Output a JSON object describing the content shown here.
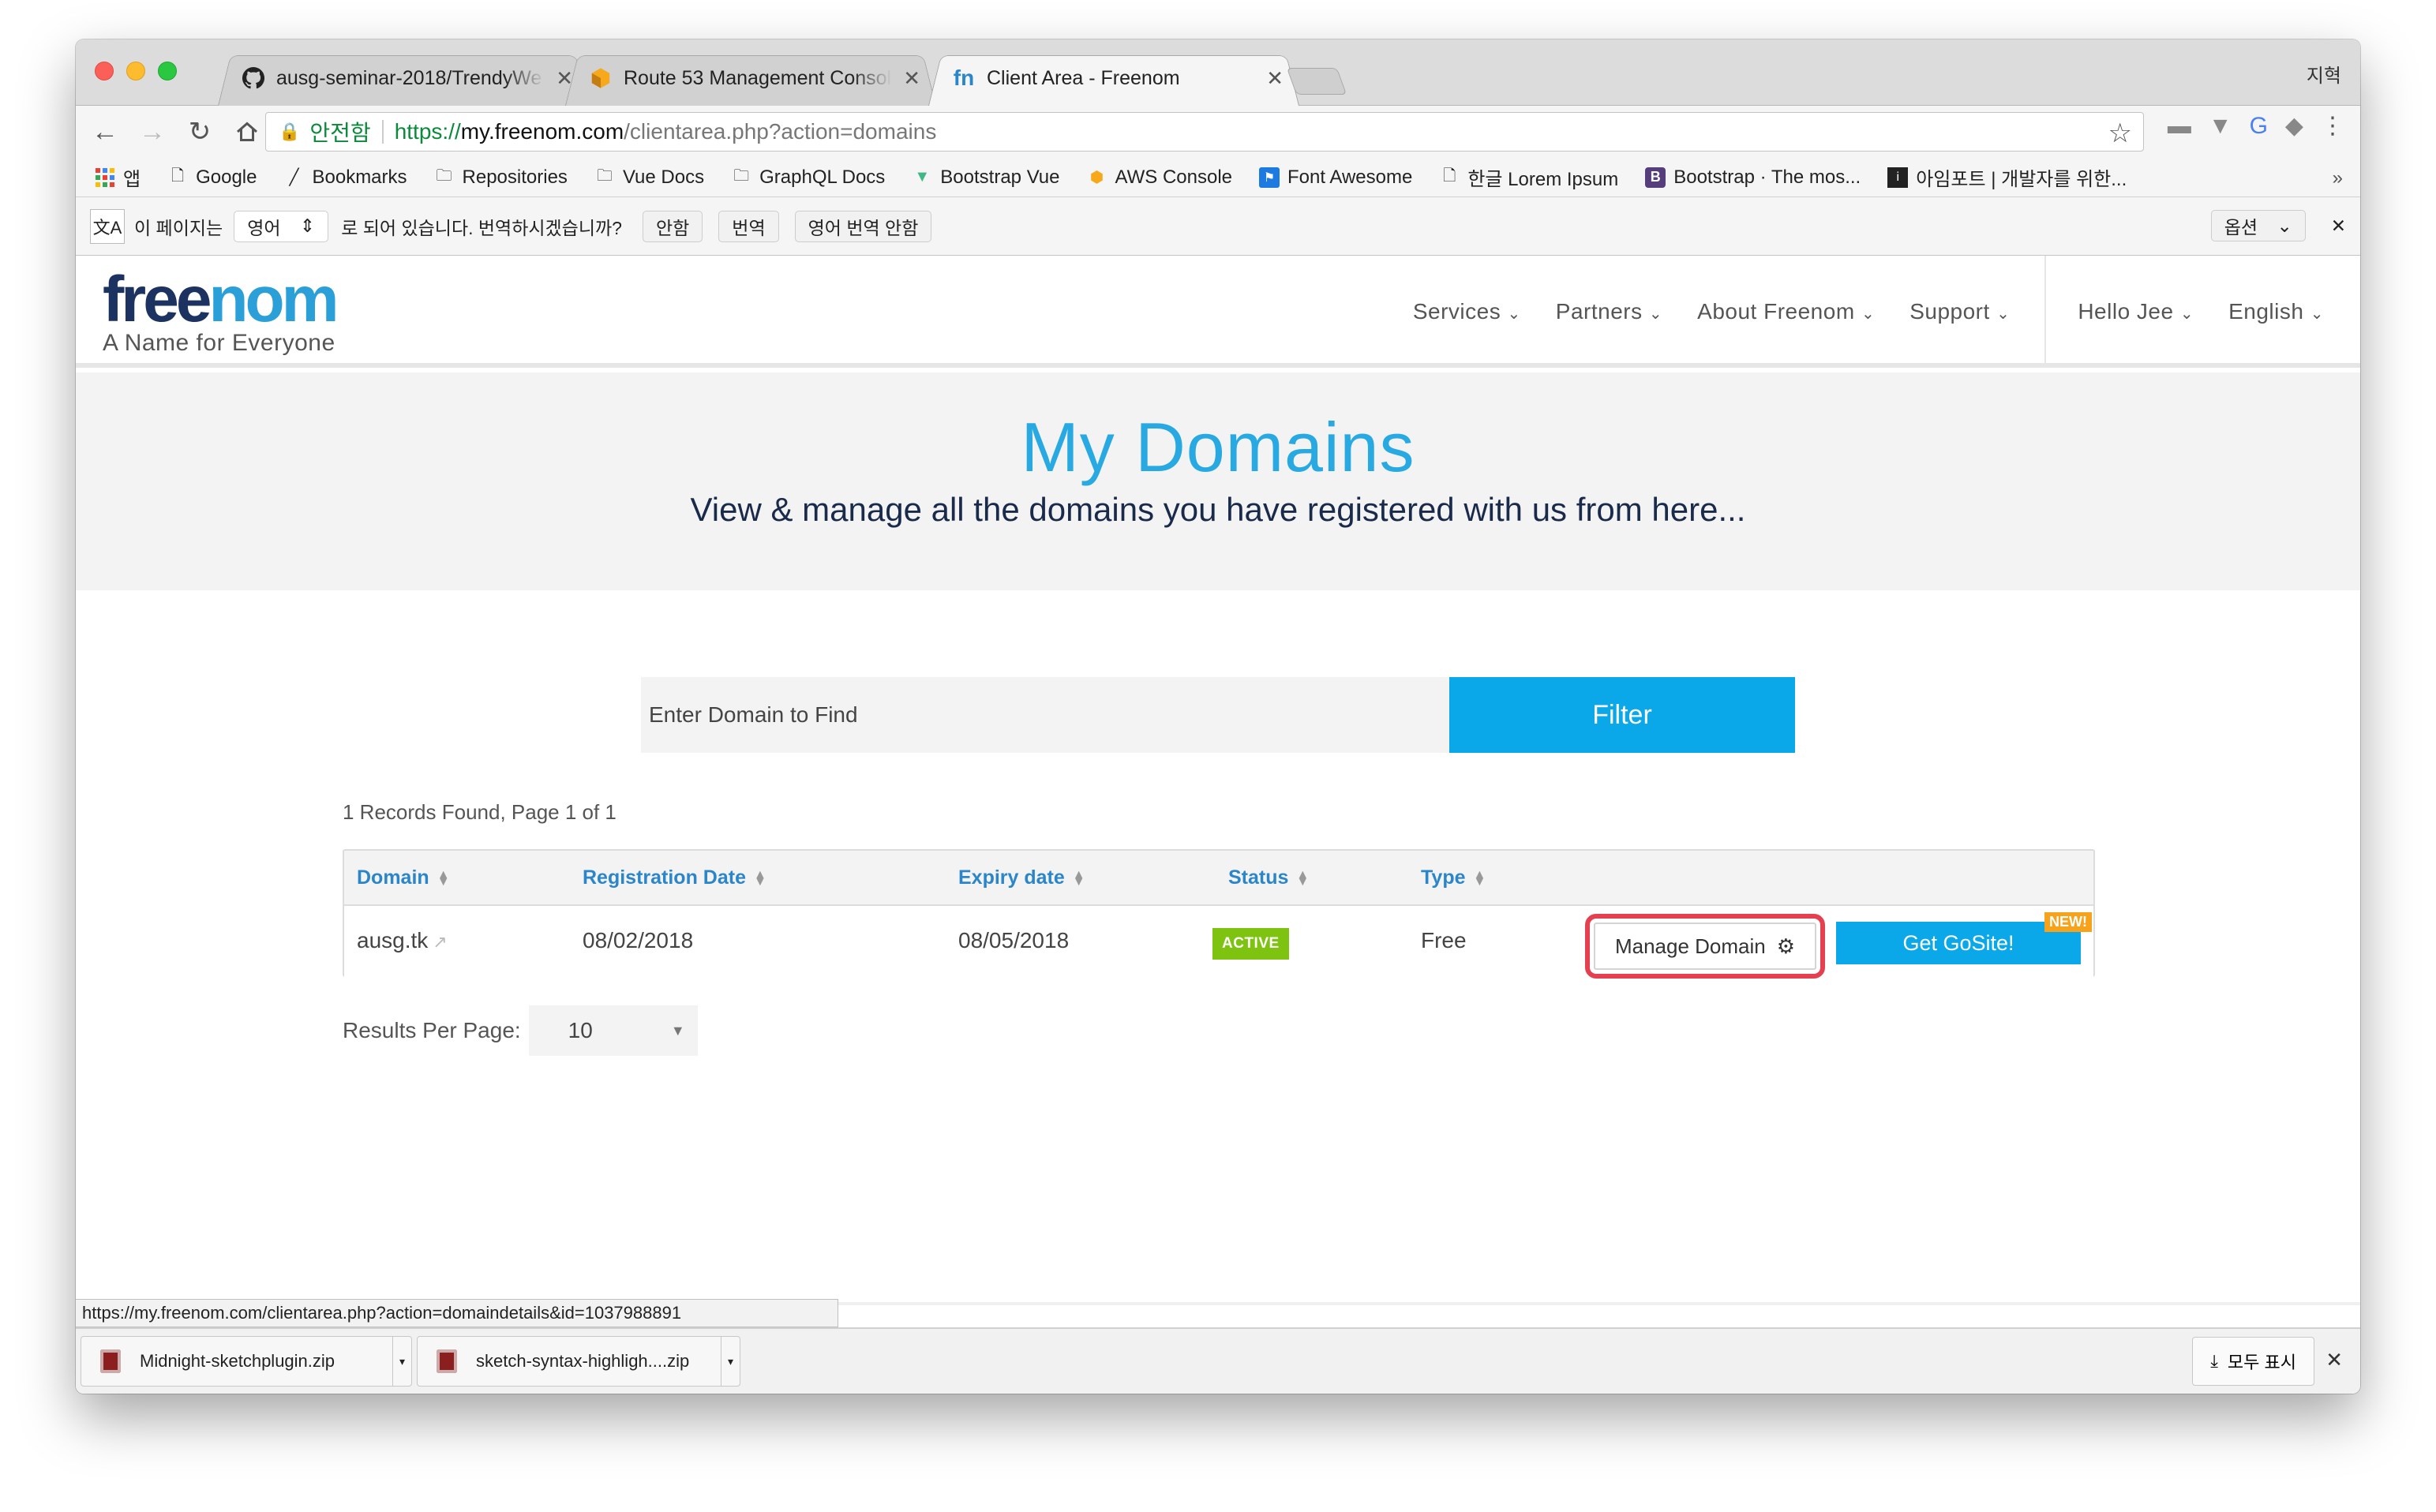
{
  "browser": {
    "profile": "지혁",
    "tabs": [
      {
        "label": "ausg-seminar-2018/TrendyWe",
        "close": "✕",
        "icon": "github-icon"
      },
      {
        "label": "Route 53 Management Consol",
        "close": "✕",
        "icon": "aws-icon"
      },
      {
        "label": "Client Area - Freenom",
        "close": "✕",
        "icon": "freenom-icon"
      }
    ],
    "address": {
      "secure_label": "안전함",
      "scheme": "https://",
      "host": "my.freenom.com",
      "path": "/clientarea.php?action=domains"
    },
    "bookmarks": [
      {
        "label": "앱",
        "icon": "apps-icon"
      },
      {
        "label": "Google",
        "icon": "page-icon"
      },
      {
        "label": "Bookmarks",
        "icon": "bookmark-icon"
      },
      {
        "label": "Repositories",
        "icon": "folder-icon"
      },
      {
        "label": "Vue Docs",
        "icon": "folder-icon"
      },
      {
        "label": "GraphQL Docs",
        "icon": "folder-icon"
      },
      {
        "label": "Bootstrap Vue",
        "icon": "vue-icon"
      },
      {
        "label": "AWS Console",
        "icon": "aws-icon"
      },
      {
        "label": "Font Awesome",
        "icon": "flag-icon"
      },
      {
        "label": "한글 Lorem Ipsum",
        "icon": "page-icon"
      },
      {
        "label": "Bootstrap · The mos...",
        "icon": "bootstrap-icon"
      },
      {
        "label": "아임포트 | 개발자를 위한...",
        "icon": "iamport-icon"
      }
    ],
    "bookmarks_more": "»",
    "translate": {
      "prefix": "이 페이지는",
      "language": "영어",
      "suffix": "로 되어 있습니다. 번역하시겠습니까?",
      "no": "안함",
      "translate": "번역",
      "never": "영어 번역 안함",
      "options": "옵션",
      "close": "✕"
    },
    "status_url": "https://my.freenom.com/clientarea.php?action=domaindetails&id=1037988891",
    "downloads": [
      {
        "name": "Midnight-sketchplugin.zip"
      },
      {
        "name": "sketch-syntax-highligh....zip"
      }
    ],
    "show_all": "모두 표시",
    "downloads_close": "✕"
  },
  "site": {
    "logo": {
      "part1": "free",
      "part2": "nom",
      "tagline": "A Name for Everyone"
    },
    "nav": [
      "Services",
      "Partners",
      "About Freenom",
      "Support"
    ],
    "user_nav": [
      "Hello Jee",
      "English"
    ],
    "hero": {
      "title": "My Domains",
      "subtitle": "View & manage all the domains you have registered with us from here..."
    },
    "search": {
      "placeholder": "Enter Domain to Find",
      "button": "Filter"
    },
    "records": "1 Records Found, Page 1 of 1",
    "table": {
      "headers": [
        "Domain",
        "Registration Date",
        "Expiry date",
        "Status",
        "Type"
      ],
      "rows": [
        {
          "domain": "ausg.tk",
          "registration": "08/02/2018",
          "expiry": "08/05/2018",
          "status": "ACTIVE",
          "type": "Free",
          "manage": "Manage Domain",
          "gosite": "Get GoSite!",
          "new_badge": "NEW!"
        }
      ]
    },
    "results_per_page": {
      "label": "Results Per Page:",
      "value": "10"
    }
  },
  "colors": {
    "accent": "#0aa8e8",
    "active": "#7ec310",
    "highlight": "#e5404f",
    "navy": "#1c3260"
  }
}
